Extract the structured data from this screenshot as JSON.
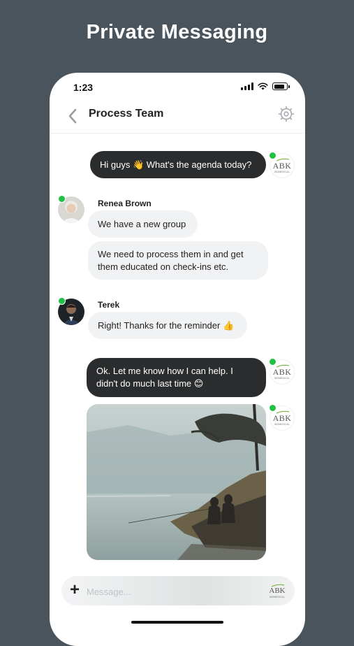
{
  "hero": {
    "title": "Private Messaging"
  },
  "status_bar": {
    "time": "1:23"
  },
  "header": {
    "title": "Process Team"
  },
  "messages": [
    {
      "direction": "outgoing",
      "text": "Hi guys 👋 What's the agenda today?",
      "avatar": "ABK"
    },
    {
      "direction": "incoming",
      "sender": "Renea Brown",
      "text": "We have a new group"
    },
    {
      "direction": "incoming",
      "sender": "Renea Brown",
      "text": "We need to process them in and get them educated on check-ins etc."
    },
    {
      "direction": "incoming",
      "sender": "Terek",
      "text": "Right! Thanks for the reminder 👍"
    },
    {
      "direction": "outgoing",
      "text": "Ok. Let me know how I can help. I didn't do much last time 😊",
      "avatar": "ABK"
    },
    {
      "direction": "outgoing",
      "type": "image",
      "avatar": "ABK"
    }
  ],
  "logo": {
    "text": "ABK",
    "subtitle": "BIOMEDICAL"
  },
  "composer": {
    "placeholder": "Message..."
  },
  "colors": {
    "background": "#4a545d",
    "outgoing_bubble": "#2a2c2e",
    "incoming_bubble": "#f1f2f4",
    "online": "#21c043"
  }
}
